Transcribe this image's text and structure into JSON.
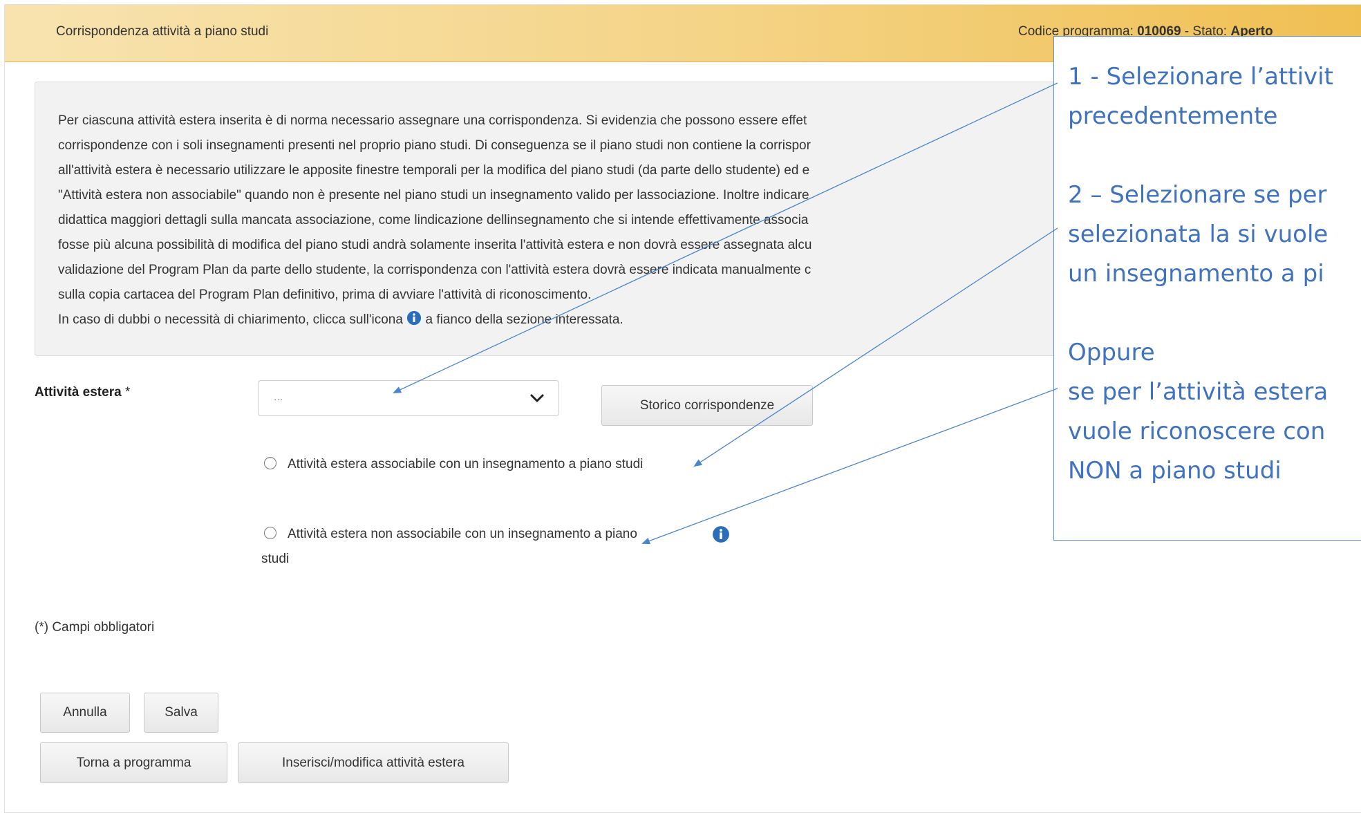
{
  "header": {
    "title": "Corrispondenza attività a piano studi",
    "code_label": "Codice programma: ",
    "code_value": "010069",
    "state_label": " - Stato: ",
    "state_value": "Aperto"
  },
  "info": {
    "lines": [
      "Per ciascuna attività estera inserita è di norma necessario assegnare una corrispondenza. Si evidenzia che possono essere effet",
      "corrispondenze con i soli insegnamenti presenti nel proprio piano studi. Di conseguenza se il piano studi non contiene la corrispor",
      "all'attività estera è necessario utilizzare le apposite finestre temporali per la modifica del piano studi (da parte dello studente) ed e",
      "\"Attività estera non associabile\" quando non è presente nel piano studi un insegnamento valido per lassociazione. Inoltre indicare",
      "didattica maggiori dettagli sulla mancata associazione, come lindicazione dellinsegnamento che si intende effettivamente associa",
      "fosse più alcuna possibilità di modifica del piano studi andrà solamente inserita l'attività estera e non dovrà essere assegnata alcu",
      "validazione del Program Plan da parte dello studente, la corrispondenza con l'attività estera dovrà essere indicata manualmente c",
      "sulla copia cartacea del Program Plan definitivo, prima di avviare l'attività di riconoscimento."
    ],
    "last_line_before": "In caso di dubbi o necessità di chiarimento, clicca sull'icona ",
    "last_line_after": " a fianco della sezione interessata."
  },
  "form": {
    "field_label": "Attività estera",
    "required_mark": " *",
    "select_placeholder": "...",
    "storico_button": "Storico corrispondenze",
    "radio1_label": "Attività estera associabile con un insegnamento a piano studi",
    "radio2_label": "Attività estera non associabile con un insegnamento a piano studi",
    "required_note": "(*) Campi obbligatori"
  },
  "buttons": {
    "annulla": "Annulla",
    "salva": "Salva",
    "torna": "Torna a programma",
    "inserisci": "Inserisci/modifica attività estera"
  },
  "callout": {
    "line1": "1 - Selezionare l’attivit",
    "line2": "precedentemente",
    "line3": "2 – Selezionare se per",
    "line4": "selezionata la si vuole",
    "line5": "un insegnamento a pi",
    "line6": "Oppure",
    "line7": " se per l’attività estera",
    "line8": "vuole riconoscere con",
    "line9": "NON  a piano studi"
  },
  "colors": {
    "header_gradient_end": "#f0bf52",
    "callout_text": "#3f72c0",
    "info_icon": "#2a6ebb"
  },
  "icons": [
    "info-icon",
    "chevron-down-icon"
  ]
}
